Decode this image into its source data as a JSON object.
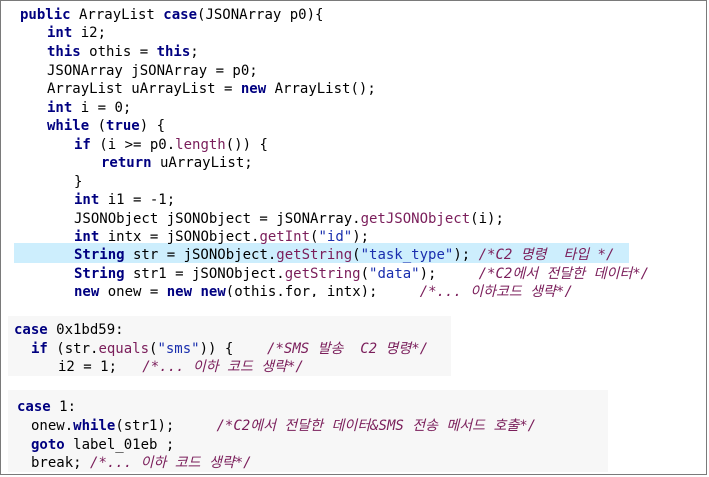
{
  "code_panel_1": {
    "lines": [
      "public ArrayList case(JSONArray p0){",
      "int i2;",
      "this othis = this;",
      "JSONArray jSONArray = p0;",
      "ArrayList uArrayList = new ArrayList();",
      "int i = 0;",
      "while (true) {",
      "if (i >= p0.length()) {",
      "return uArrayList;",
      "}",
      "int i1 = -1;",
      "JSONObject jSONObject = jSONArray.getJSONObject(i);",
      "int intx = jSONObject.getInt(\"id\");",
      "String str = jSONObject.getString(\"task_type\"); /*C2 명령  타입 */",
      "String str1 = jSONObject.getString(\"data\");     /*C2에서 전달한 데이터*/",
      "new onew = new new(othis.for, intx);     /*... 이하코드 생략*/"
    ]
  },
  "code_panel_2": {
    "lines": [
      "case 0x1bd59:",
      "if (str.equals(\"sms\")) {    /*SMS 발송  C2 명령*/",
      "i2 = 1;   /*... 이하 코드 생략*/"
    ]
  },
  "code_panel_3": {
    "lines": [
      "case 1:",
      "onew.while(str1);     /*C2에서 전달한 데이터&SMS 전송 메서드 호출*/",
      "goto label_01eb ;",
      "break; /*... 이하 코드 생략*/"
    ]
  },
  "colors": {
    "keyword": "#000080",
    "method": "#7a1d5a",
    "string": "#1a2fae",
    "comment": "#7a1d5a",
    "highlight": "#cdeefd"
  }
}
